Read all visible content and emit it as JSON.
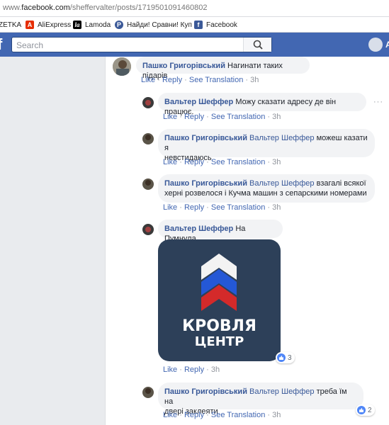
{
  "browser": {
    "url_prefix": "www.",
    "url_domain": "facebook.com",
    "url_path": "/sheffervalter/posts/1719501091460802"
  },
  "bookmarks": [
    {
      "label": "ZETKA",
      "icon": "none"
    },
    {
      "label": "AliExpress",
      "icon": "aliexpress-icon",
      "color": "#e62e04"
    },
    {
      "label": "Lamoda",
      "icon": "lamoda-icon",
      "color": "#000000"
    },
    {
      "label": "Найди! Сравни! Куп",
      "icon": "price-compare-icon",
      "color": "#3b5998"
    },
    {
      "label": "Facebook",
      "icon": "facebook-icon",
      "color": "#3b5998"
    }
  ],
  "fb_header": {
    "logo": "f",
    "search_placeholder": "Search",
    "user_initial": "A"
  },
  "colors": {
    "fb_blue": "#4267b2",
    "link": "#385898",
    "bubble": "#f2f3f5",
    "meta": "#90949c",
    "logo_bg": "#2d4059",
    "stripe_white": "#f3f3f3",
    "stripe_blue": "#2458d6",
    "stripe_red": "#d42a2a"
  },
  "comments": [
    {
      "author": "Пашко Григорівський",
      "text": "Нагинати таких підарів",
      "like": "Like",
      "reply": "Reply",
      "translate": "See Translation",
      "time": "3h"
    },
    {
      "author": "Вальтер Шеффер",
      "text": "Можу сказати адресу де він працює.",
      "like": "Like",
      "reply": "Reply",
      "translate": "See Translation",
      "time": "3h",
      "more": "···"
    },
    {
      "author": "Пашко Григорівський",
      "mention": "Вальтер Шеффер",
      "text_line1": "можеш казати я",
      "text_line2": "невстидаюсь",
      "like": "Like",
      "reply": "Reply",
      "translate": "See Translation",
      "time": "3h"
    },
    {
      "author": "Пашко Григорівський",
      "mention": "Вальтер Шеффер",
      "text_line1": "взагалі всякої",
      "text_line2": "херні розвелося і Кучма машин з сепарскими номерами",
      "like": "Like",
      "reply": "Reply",
      "translate": "See Translation",
      "time": "3h"
    },
    {
      "author": "Вальтер Шеффер",
      "text": "На Пумнула.",
      "image_line1": "КРОВЛЯ",
      "image_line2": "ЦЕНТР",
      "reaction_count": "3",
      "like": "Like",
      "reply": "Reply",
      "time": "3h"
    },
    {
      "author": "Пашко Григорівський",
      "mention": "Вальтер Шеффер",
      "text_line1": "треба їм на",
      "text_line2": "двері заклеяти",
      "reaction_count": "2",
      "like": "Like",
      "reply": "Reply",
      "translate": "See Translation",
      "time": "3h"
    }
  ]
}
